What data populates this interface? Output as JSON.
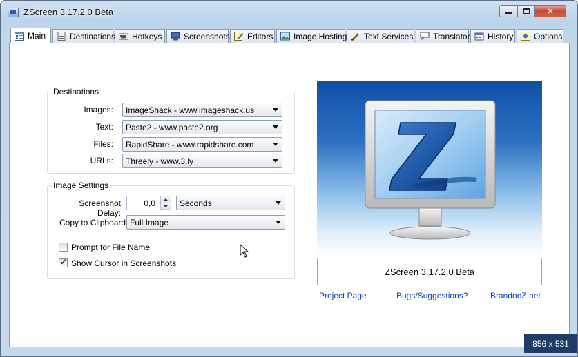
{
  "window": {
    "title": "ZScreen 3.17.2.0 Beta"
  },
  "tabs": [
    {
      "label": "Main",
      "icon": "main-icon"
    },
    {
      "label": "Destinations",
      "icon": "destinations-icon"
    },
    {
      "label": "Hotkeys",
      "icon": "keyboard-icon"
    },
    {
      "label": "Screenshots",
      "icon": "monitor-icon"
    },
    {
      "label": "Editors",
      "icon": "editor-icon"
    },
    {
      "label": "Image Hosting",
      "icon": "image-icon"
    },
    {
      "label": "Text Services",
      "icon": "text-icon"
    },
    {
      "label": "Translator",
      "icon": "speech-bubble-icon"
    },
    {
      "label": "History",
      "icon": "history-icon"
    },
    {
      "label": "Options",
      "icon": "options-icon"
    }
  ],
  "destinations": {
    "title": "Destinations",
    "rows": [
      {
        "label": "Images:",
        "value": "ImageShack - www.imageshack.us"
      },
      {
        "label": "Text:",
        "value": "Paste2 - www.paste2.org"
      },
      {
        "label": "Files:",
        "value": "RapidShare - www.rapidshare.com"
      },
      {
        "label": "URLs:",
        "value": "Threely - www.3.ly"
      }
    ]
  },
  "image_settings": {
    "title": "Image Settings",
    "delay_label": "Screenshot Delay:",
    "delay_value": "0,0",
    "delay_unit": "Seconds",
    "clipboard_label": "Copy to Clipboard:",
    "clipboard_value": "Full Image",
    "prompt_label": "Prompt for File Name",
    "prompt_checked": false,
    "cursor_label": "Show Cursor in Screenshots",
    "cursor_checked": true
  },
  "about": {
    "version_text": "ZScreen 3.17.2.0 Beta",
    "links": [
      "Project Page",
      "Bugs/Suggestions?",
      "BrandonZ.net"
    ]
  },
  "overlay": {
    "dimensions": "856 x 531"
  },
  "colors": {
    "link": "#0a3fb5",
    "accent": "#1e3d66"
  }
}
